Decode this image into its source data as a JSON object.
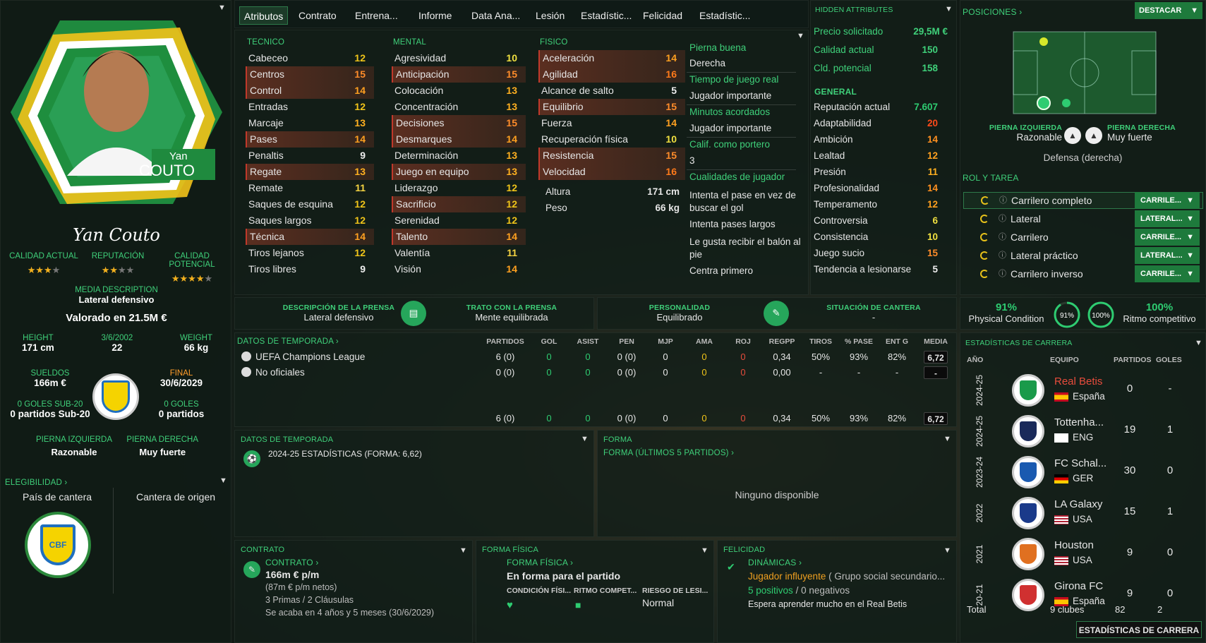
{
  "player": {
    "first_name": "Yan",
    "last_name": "COUTO",
    "signature_text": "Yan Couto",
    "media_description_label": "MEDIA DESCRIPTION",
    "media_description": "Lateral defensivo",
    "valued": "Valorado en 21.5M €",
    "ratings": {
      "ca_label": "CALIDAD ACTUAL",
      "rep_label": "REPUTACIÓN",
      "pa_label": "CALIDAD POTENCIAL",
      "ca_stars": 3.5,
      "rep_stars": 2.5,
      "pa_stars": 4.5
    },
    "height_label": "HEIGHT",
    "height": "171 cm",
    "dob": "3/6/2002",
    "age": "22",
    "weight_label": "WEIGHT",
    "weight": "66 kg",
    "wage_label": "SUELDOS",
    "wage": "166m €",
    "final_label": "FINAL",
    "final": "30/6/2029",
    "u20_goals_label": "0 GOLES SUB-20",
    "u20_apps": "0 partidos Sub-20",
    "goals_label": "0 GOLES",
    "apps": "0 partidos",
    "left_foot_label": "PIERNA IZQUIERDA",
    "left_foot": "Razonable",
    "right_foot_label": "PIERNA DERECHA",
    "right_foot": "Muy fuerte",
    "eligibility_label": "ELEGIBILIDAD",
    "country_label": "País de cantera",
    "origin_label": "Cantera de origen"
  },
  "tabs": [
    "Atributos",
    "Contrato",
    "Entrena...",
    "Informe",
    "Data Ana...",
    "Lesión",
    "Estadístic...",
    "Felicidad",
    "Estadístic..."
  ],
  "technical": {
    "title": "TECNICO",
    "items": [
      [
        "Cabeceo",
        12
      ],
      [
        "Centros",
        15
      ],
      [
        "Control",
        14
      ],
      [
        "Entradas",
        12
      ],
      [
        "Marcaje",
        13
      ],
      [
        "Pases",
        14
      ],
      [
        "Penaltis",
        9
      ],
      [
        "Regate",
        13
      ],
      [
        "Remate",
        11
      ],
      [
        "Saques de esquina",
        12
      ],
      [
        "Saques largos",
        12
      ],
      [
        "Técnica",
        14
      ],
      [
        "Tiros lejanos",
        12
      ],
      [
        "Tiros libres",
        9
      ]
    ]
  },
  "mental": {
    "title": "MENTAL",
    "items": [
      [
        "Agresividad",
        10
      ],
      [
        "Anticipación",
        15
      ],
      [
        "Colocación",
        13
      ],
      [
        "Concentración",
        13
      ],
      [
        "Decisiones",
        15
      ],
      [
        "Desmarques",
        14
      ],
      [
        "Determinación",
        13
      ],
      [
        "Juego en equipo",
        13
      ],
      [
        "Liderazgo",
        12
      ],
      [
        "Sacrificio",
        12
      ],
      [
        "Serenidad",
        12
      ],
      [
        "Talento",
        14
      ],
      [
        "Valentía",
        11
      ],
      [
        "Visión",
        14
      ]
    ]
  },
  "physical": {
    "title": "FISICO",
    "items": [
      [
        "Aceleración",
        14
      ],
      [
        "Agilidad",
        16
      ],
      [
        "Alcance de salto",
        5
      ],
      [
        "Equilibrio",
        15
      ],
      [
        "Fuerza",
        14
      ],
      [
        "Recuperación física",
        10
      ],
      [
        "Resistencia",
        15
      ],
      [
        "Velocidad",
        16
      ]
    ],
    "height_label": "Altura",
    "height": "171 cm",
    "weight_label": "Peso",
    "weight": "66 kg"
  },
  "side_info": {
    "foot_label": "Pierna buena",
    "foot": "Derecha",
    "time_label": "Tiempo de juego real",
    "time": "Jugador importante",
    "min_label": "Minutos acordados",
    "min": "Jugador importante",
    "gk_label": "Calif. como portero",
    "gk": "3",
    "traits_label": "Cualidades de jugador",
    "traits": [
      "Intenta el pase en vez de buscar el gol",
      "Intenta pases largos",
      "Le gusta recibir el balón al pie",
      "Centra primero"
    ]
  },
  "hidden": {
    "title": "HIDDEN ATTRIBUTES",
    "asking_label": "Precio solicitado",
    "asking": "29,5M €",
    "ca_label": "Calidad actual",
    "ca": "150",
    "pa_label": "Cld. potencial",
    "pa": "158",
    "general_label": "GENERAL",
    "items": [
      [
        "Reputación actual",
        "7.607"
      ],
      [
        "Adaptabilidad",
        "20"
      ],
      [
        "Ambición",
        "14"
      ],
      [
        "Lealtad",
        "12"
      ],
      [
        "Presión",
        "11"
      ],
      [
        "Profesionalidad",
        "14"
      ],
      [
        "Temperamento",
        "12"
      ],
      [
        "Controversia",
        "6"
      ],
      [
        "Consistencia",
        "10"
      ],
      [
        "Juego sucio",
        "15"
      ],
      [
        "Tendencia a lesionarse",
        "5"
      ]
    ]
  },
  "positions": {
    "title": "POSICIONES",
    "highlight_btn": "DESTACAR",
    "left_foot_label": "PIERNA IZQUIERDA",
    "left_foot": "Razonable",
    "right_foot_label": "PIERNA DERECHA",
    "right_foot": "Muy fuerte",
    "position": "Defensa (derecha)"
  },
  "roles": {
    "title": "ROL Y TAREA",
    "items": [
      [
        "Carrilero completo",
        "CARRILE..."
      ],
      [
        "Lateral",
        "LATERAL..."
      ],
      [
        "Carrilero",
        "CARRILE..."
      ],
      [
        "Lateral práctico",
        "LATERAL..."
      ],
      [
        "Carrilero inverso",
        "CARRILE..."
      ]
    ]
  },
  "press": {
    "desc_label": "DESCRIPCIÓN DE LA PRENSA",
    "desc": "Lateral defensivo",
    "handling_label": "TRATO CON LA PRENSA",
    "handling": "Mente equilibrada",
    "personality_label": "PERSONALIDAD",
    "personality": "Equilibrado",
    "youth_label": "SITUACIÓN DE CANTERA",
    "youth": "-"
  },
  "condition": {
    "physical_pct": "91%",
    "physical_label": "Physical Condition",
    "ring1": "91%",
    "ring2": "100%",
    "match_pct": "100%",
    "match_label": "Ritmo competitivo",
    "physical_value": 0.91,
    "match_value": 1.0
  },
  "season": {
    "title": "DATOS DE TEMPORADA",
    "headers": [
      "PARTIDOS",
      "GOL",
      "ASIST",
      "PEN",
      "MJP",
      "AMA",
      "ROJ",
      "REGPP",
      "TIROS",
      "% PASE",
      "ENT G",
      "MEDIA"
    ],
    "rows": [
      {
        "name": "UEFA Champions League",
        "vals": [
          "6 (0)",
          "0",
          "0",
          "0 (0)",
          "0",
          "0",
          "0",
          "0,34",
          "50%",
          "93%",
          "82%"
        ],
        "media": "6,72"
      },
      {
        "name": "No oficiales",
        "vals": [
          "0 (0)",
          "0",
          "0",
          "0 (0)",
          "0",
          "0",
          "0",
          "0,00",
          "-",
          "-",
          "-"
        ],
        "media": "-"
      }
    ],
    "total": {
      "vals": [
        "6 (0)",
        "0",
        "0",
        "0 (0)",
        "0",
        "0",
        "0",
        "0,34",
        "50%",
        "93%",
        "82%"
      ],
      "media": "6,72"
    }
  },
  "season_small": {
    "title": "DATOS DE TEMPORADA",
    "line": "2024-25 ESTADÍSTICAS (FORMA: 6,62)"
  },
  "form": {
    "title": "FORMA",
    "sub": "FORMA (ÚLTIMOS 5 PARTIDOS)",
    "empty": "Ninguno disponible"
  },
  "contract": {
    "title": "CONTRATO",
    "sub": "CONTRATO",
    "wage": "166m € p/m",
    "net": "(87m € p/m netos)",
    "bonuses": "3 Primas / 2 Cláusulas",
    "expires": "Se acaba en 4 años y 5 meses (30/6/2029)"
  },
  "fitness": {
    "title": "FORMA FÍSICA",
    "sub": "FORMA FÍSICA",
    "status": "En forma para el partido",
    "cond_label": "CONDICIÓN FÍSI...",
    "match_label": "RITMO COMPET...",
    "injury_label": "RIESGO DE LESI...",
    "injury": "Normal"
  },
  "happiness": {
    "title": "FELICIDAD",
    "sub": "DINÁMICAS",
    "influence": "Jugador influyente",
    "group": "( Grupo social secundario...",
    "positives": "5 positivos",
    "sep": "/",
    "negatives": "0 negativos",
    "expects": "Espera aprender mucho en el Real Betis"
  },
  "career": {
    "title": "ESTADÍSTICAS DE CARRERA",
    "headers": [
      "AÑO",
      "EQUIPO",
      "PARTIDOS",
      "GOLES"
    ],
    "rows": [
      {
        "year": "2024-25",
        "team": "Real Betis",
        "country": "España",
        "apps": "0",
        "goals": "-"
      },
      {
        "year": "2024-25",
        "team": "Tottenha...",
        "country": "ENG",
        "apps": "19",
        "goals": "1"
      },
      {
        "year": "2023-24",
        "team": "FC Schal...",
        "country": "GER",
        "apps": "30",
        "goals": "0"
      },
      {
        "year": "2022",
        "team": "LA Galaxy",
        "country": "USA",
        "apps": "15",
        "goals": "1"
      },
      {
        "year": "2021",
        "team": "Houston",
        "country": "USA",
        "apps": "9",
        "goals": "0"
      },
      {
        "year": "20-21",
        "team": "Girona FC",
        "country": "España",
        "apps": "9",
        "goals": "0"
      }
    ],
    "total_label": "Total",
    "total_clubs": "9 clubes",
    "total_apps": "82",
    "total_goals": "2",
    "button": "ESTADÍSTICAS DE CARRERA"
  },
  "colors": {
    "accent": "#2ecc71",
    "button": "#1e7a3c",
    "highlight": "#963c28"
  }
}
